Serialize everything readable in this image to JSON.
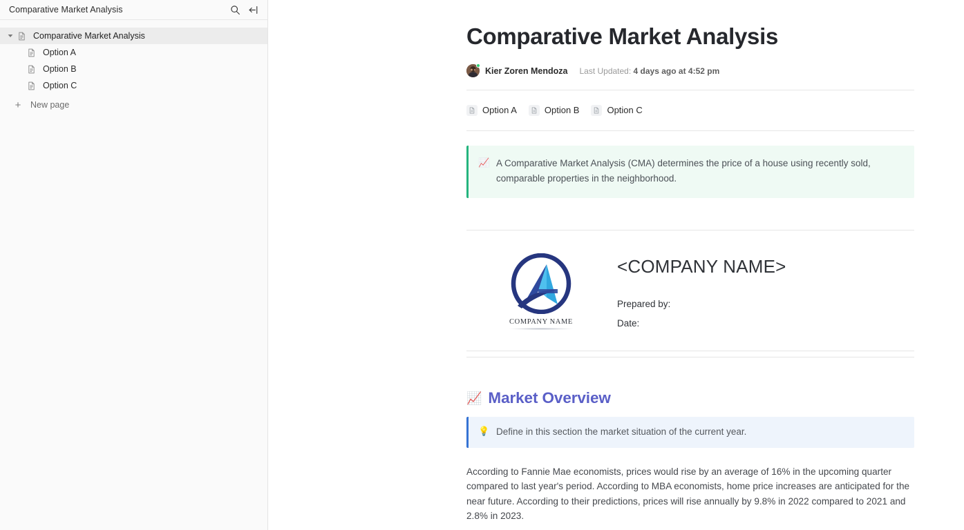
{
  "sidebar": {
    "title": "Comparative Market Analysis",
    "search_icon": "search-icon",
    "collapse_icon": "collapse-sidebar-icon",
    "tree": [
      {
        "label": "Comparative Market Analysis",
        "icon": "doc-page-icon",
        "twisty": "▾",
        "active": true,
        "level": 0
      },
      {
        "label": "Option A",
        "icon": "doc-page-icon",
        "active": false,
        "level": 1
      },
      {
        "label": "Option B",
        "icon": "doc-page-icon",
        "active": false,
        "level": 1
      },
      {
        "label": "Option C",
        "icon": "doc-page-icon",
        "active": false,
        "level": 1
      }
    ],
    "new_page_label": "New page",
    "new_page_icon": "plus-icon"
  },
  "doc": {
    "title": "Comparative Market Analysis",
    "author": "Kier Zoren Mendoza",
    "updated_prefix": "Last Updated:",
    "updated_value": "4 days ago at 4:52 pm",
    "avatar_name": "avatar",
    "presence_status": "online",
    "subpages": [
      {
        "label": "Option A",
        "icon": "doc-page-icon"
      },
      {
        "label": "Option B",
        "icon": "doc-page-icon"
      },
      {
        "label": "Option C",
        "icon": "doc-page-icon"
      }
    ],
    "callout_green": {
      "icon": "📈",
      "icon_name": "chart-increasing-icon",
      "text": "A Comparative Market Analysis (CMA) determines the price of a house using recently sold, comparable properties in the neighborhood.",
      "accent": "#24b47e",
      "background": "#effaf4"
    },
    "company": {
      "logo_word": "COMPANY NAME",
      "name": "<COMPANY NAME>",
      "prepared_by_label": "Prepared by:",
      "date_label": "Date:",
      "logo_ring_color": "#26367f",
      "logo_light_blue": "#31a8e0",
      "logo_mid_blue": "#2f4a9e"
    },
    "market_overview": {
      "icon": "📈",
      "icon_name": "chart-increasing-icon",
      "heading": "Market Overview",
      "heading_color": "#5a5fc7",
      "callout": {
        "icon": "💡",
        "icon_name": "lightbulb-icon",
        "text": "Define in this section the market situation of the current year.",
        "accent": "#3573d4",
        "background": "#eef4fc"
      },
      "paragraph": "According to Fannie Mae economists, prices would rise by an average of 16% in the upcoming quarter compared to last year's period. According to MBA economists, home price increases are anticipated for the near future. According to their predictions, prices will rise annually by 9.8% in 2022 compared to 2021 and 2.8% in 2023."
    }
  }
}
